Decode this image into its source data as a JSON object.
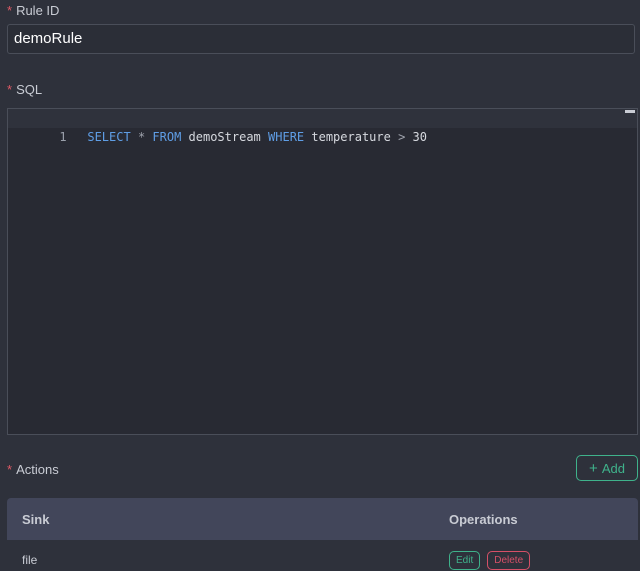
{
  "form": {
    "rule_id": {
      "required_mark": "*",
      "label": "Rule ID",
      "value": "demoRule"
    },
    "sql": {
      "required_mark": "*",
      "label": "SQL",
      "line_number": "1",
      "tokens": {
        "select": "SELECT",
        "star": " * ",
        "from": "FROM",
        "stream": " demoStream ",
        "where": "WHERE",
        "field": " temperature ",
        "gt": ">",
        "value": " 30"
      }
    },
    "actions": {
      "required_mark": "*",
      "label": "Actions",
      "add_label": "Add",
      "add_icon": "plus-icon"
    }
  },
  "table": {
    "headers": [
      "Sink",
      "Operations"
    ],
    "rows": [
      {
        "sink": "file",
        "edit_label": "Edit",
        "delete_label": "Delete"
      }
    ]
  },
  "colors": {
    "background": "#2e313b",
    "accent_green": "#3fb28b",
    "danger_red": "#d65067",
    "keyword_blue": "#5f9ee6",
    "required_red": "#e05a66"
  }
}
